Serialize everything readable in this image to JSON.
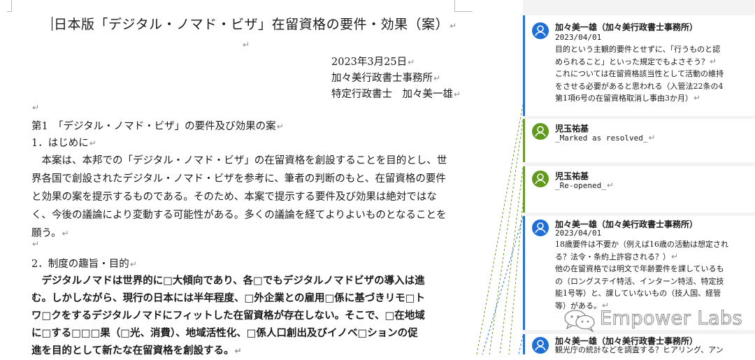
{
  "pilcrow": "↵",
  "document": {
    "title": "日本版「デジタル・ノマド・ビザ」在留資格の要件・効果（案）",
    "date": "2023年3月25日",
    "office": "加々美行政書士事務所",
    "author_line": "特定行政書士　加々美一雄",
    "section1_heading": "第1　「デジタル・ノマド・ビザ」の要件及び効果の案",
    "section1_sub": "1．はじめに",
    "para1": [
      "　本案は、本邦での「デジタル・ノマド・ビザ」の在留資格を創設することを目的とし、世",
      "界各国で創設されたデジタル・ノマド・ビザを参考に、筆者の判断のもと、在留資格の要件",
      "と効果の案を提示するものである。そのため、本案で提示する要件及び効果は絶対ではな",
      "く、今後の議論により変動する可能性がある。多くの議論を経てよりよいものとなることを",
      "願う。"
    ],
    "section2_sub": "2．制度の趣旨・目的",
    "para2": [
      "　デジタルノマドは世界的に□大傾向であり、各□でもデジタルノマドビザの導入は進",
      "む。しかしながら、現行の日本には半年程度、□外企業との雇用□係に基づきリモ□ト",
      "ワ□クをするデジタルノマドにフィットした在留資格が存在しない。そこで、□在地域",
      "に□する□□□果（□光、消費）、地域活性化、□係人口創出及びイノベ□ションの促",
      "進を目的として新たな在留資格を創設する。"
    ]
  },
  "comments": [
    {
      "author": "加々美一雄（加々美行政書士事務所）",
      "date": "2023/04/01",
      "lines": [
        "目的という主観的要件とせずに、「行うものと認",
        "められること」といった規定でもよさそう？",
        "これについては在留資格該当性として活動の維持",
        "をさせる必要があると思われる（入管法22条の4",
        "第1項6号の在留資格取消し事由3か月）"
      ]
    },
    {
      "author": "児玉祐基",
      "status": "_Marked as resolved_"
    },
    {
      "author": "児玉祐基",
      "status": "_Re-opened_"
    },
    {
      "author": "加々美一雄（加々美行政書士事務所）",
      "date": "2023/04/01",
      "lines": [
        "18歳要件は不要か（例えば16歳の活動は想定され",
        "る？法令・条約上許容される？）",
        "他の在留資格では明文で年齢要件を課しているも",
        "の（ロングステイ特活、インターン特活、特定技",
        "能1号等）と、課していないもの（技人国、経管",
        "等）がある。"
      ]
    },
    {
      "author": "加々美一雄（加々美行政書士事務所）",
      "lines": [
        "観光庁の統計などを調査する？ヒアリング、アン"
      ]
    }
  ],
  "watermark": {
    "text": "Empower Labs",
    "icon": "wechat-icon"
  },
  "colors": {
    "author1_bar": "#2b6fd0",
    "author2_bar": "#6b9a2e",
    "author1_avatar": "#1f6fd6",
    "author2_avatar": "#5f9a1c",
    "pane_bg": "#f3f3f3"
  }
}
